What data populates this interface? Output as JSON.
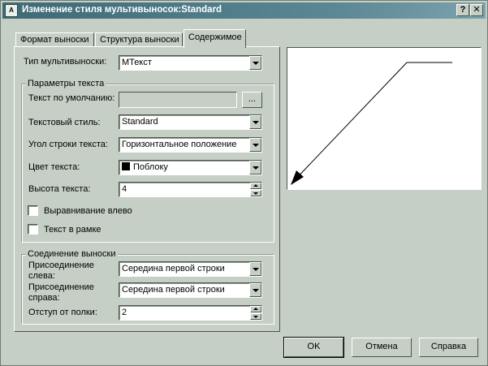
{
  "dialog": {
    "title": "Изменение стиля мультивыносок:Standard",
    "app_icon_text": "A",
    "help_glyph": "?",
    "close_glyph": "✕",
    "tabs": [
      {
        "label": "Формат выноски",
        "active": false
      },
      {
        "label": "Структура выноски",
        "active": false
      },
      {
        "label": "Содержимое",
        "active": true
      }
    ]
  },
  "settings": {
    "multileader_type_label": "Тип мультивыноски:",
    "multileader_type_value": "MТекст",
    "text_params": {
      "legend": "Параметры текста",
      "default_text_label": "Текст по умолчанию:",
      "default_text_value": "",
      "browse_label": "...",
      "text_style_label": "Текстовый стиль:",
      "text_style_value": "Standard",
      "text_angle_label": "Угол строки текста:",
      "text_angle_value": "Горизонтальное положение",
      "text_color_label": "Цвет текста:",
      "text_color_value": "Поблоку",
      "text_color_swatch": "#000000",
      "text_height_label": "Высота текста:",
      "text_height_value": "4",
      "left_justify_label": "Выравнивание влево",
      "left_justify_checked": false,
      "frame_text_label": "Текст в рамке",
      "frame_text_checked": false
    },
    "leader_connection": {
      "legend": "Соединение выноски",
      "attach_left_label_1": "Присоединение",
      "attach_left_label_2": "слева:",
      "attach_left_value": "Середина первой строки",
      "attach_right_label_1": "Присоединение",
      "attach_right_label_2": "справа:",
      "attach_right_value": "Середина первой строки",
      "landing_gap_label": "Отступ от полки:",
      "landing_gap_value": "2"
    }
  },
  "buttons": {
    "ok": "OK",
    "cancel": "Отмена",
    "help": "Справка"
  },
  "colors": {
    "window_bg": "#c5cfc5",
    "titlebar": "#3d6a76",
    "preview_bg": "#ffffff"
  }
}
